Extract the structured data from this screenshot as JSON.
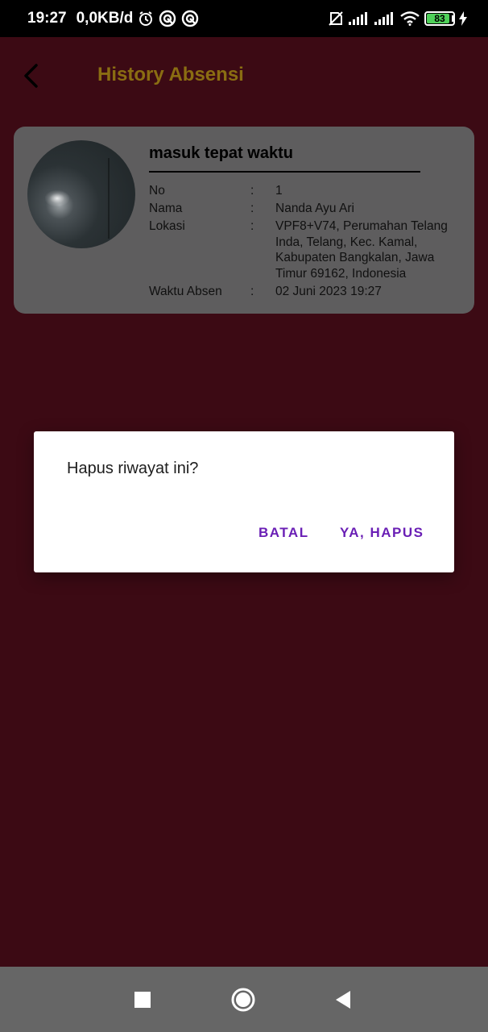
{
  "status_bar": {
    "time": "19:27",
    "speed": "0,0KB/d",
    "battery": "83",
    "icons": [
      "alarm-icon",
      "sync-icon",
      "sync-icon",
      "no-sim-icon",
      "signal-icon",
      "signal-icon",
      "wifi-icon",
      "battery-icon",
      "charging-icon"
    ]
  },
  "app_bar": {
    "title": "History Absensi",
    "back_icon": "chevron-left-icon"
  },
  "history": {
    "status": "masuk tepat waktu",
    "rows": [
      {
        "label": "No",
        "sep": ":",
        "value": "1"
      },
      {
        "label": "Nama",
        "sep": ":",
        "value": "Nanda Ayu Ari"
      },
      {
        "label": "Lokasi",
        "sep": ":",
        "value": "VPF8+V74, Perumahan Telang Inda, Telang, Kec. Kamal, Kabupaten Bangkalan, Jawa Timur 69162, Indonesia"
      },
      {
        "label": "Waktu Absen",
        "sep": ":",
        "value": "02 Juni 2023 19:27"
      }
    ]
  },
  "dialog": {
    "message": "Hapus riwayat ini?",
    "cancel_label": "BATAL",
    "confirm_label": "YA, HAPUS"
  },
  "nav_bar": {
    "icons": [
      "recent-apps-icon",
      "home-icon",
      "back-icon"
    ]
  },
  "colors": {
    "background_dimmed": "#3c0a14",
    "title": "#8a6d12",
    "dialog_button": "#6a1fb5",
    "nav_bar": "#666666"
  }
}
